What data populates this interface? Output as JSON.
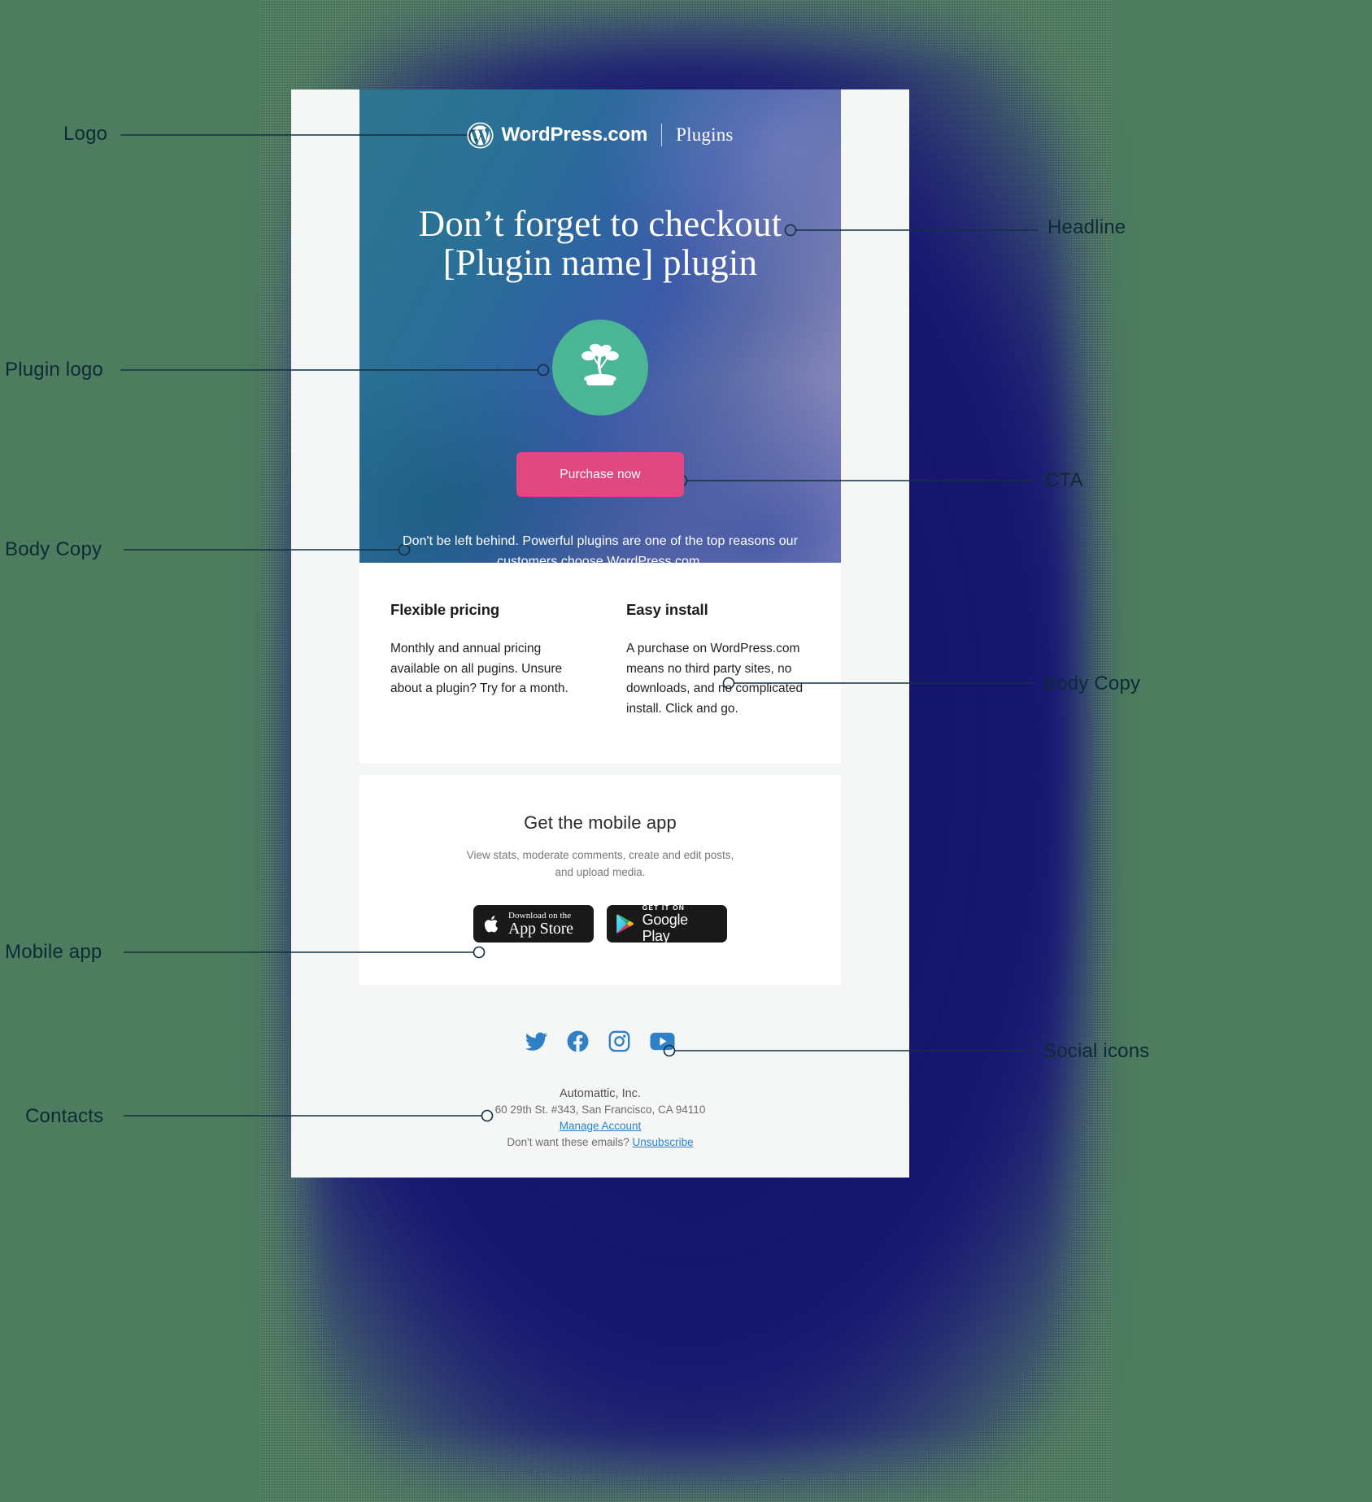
{
  "annotations": [
    {
      "id": "logo",
      "label": "Logo",
      "side": "left"
    },
    {
      "id": "headline",
      "label": "Headline",
      "side": "right"
    },
    {
      "id": "plugin-logo",
      "label": "Plugin logo",
      "side": "left"
    },
    {
      "id": "cta",
      "label": "CTA",
      "side": "right"
    },
    {
      "id": "body-copy-1",
      "label": "Body Copy",
      "side": "left"
    },
    {
      "id": "body-copy-2",
      "label": "Body Copy",
      "side": "right"
    },
    {
      "id": "mobile-app",
      "label": "Mobile app",
      "side": "left"
    },
    {
      "id": "social",
      "label": "Social icons",
      "side": "right"
    },
    {
      "id": "contacts",
      "label": "Contacts",
      "side": "left"
    }
  ],
  "email": {
    "hero": {
      "brand": {
        "name": "WordPress.com",
        "divider": "|",
        "section": "Plugins",
        "logo_icon": "wordpress-logo-icon"
      },
      "headline_line1": "Don’t forget to checkout",
      "headline_line2": "[Plugin name] plugin",
      "plugin_logo_icon": "bonsai-tree-icon",
      "plugin_logo_color": "#4ab695",
      "cta_label": "Purchase now",
      "cta_color": "#e0487f",
      "body_line1": "Don't be left behind. Powerful plugins are one of the top reasons",
      "body_line2": "our customers choose WordPress.com."
    },
    "features": [
      {
        "title": "Flexible pricing",
        "body": "Monthly and annual pricing available on all pugins. Unsure about a plugin? Try for a month."
      },
      {
        "title": "Easy install",
        "body": "A purchase on WordPress.com means no third party sites, no downloads, and no complicated install. Click and go."
      }
    ],
    "mobile": {
      "title": "Get the mobile app",
      "subtitle_line1": "View stats, moderate comments, create and",
      "subtitle_line2": "edit posts, and upload media.",
      "badges": [
        {
          "icon": "apple-icon",
          "small": "Download on the",
          "big": "App Store"
        },
        {
          "icon": "google-play-icon",
          "small": "GET IT ON",
          "big": "Google Play"
        }
      ]
    },
    "footer": {
      "social": [
        {
          "name": "twitter-icon",
          "color": "#2f80c7"
        },
        {
          "name": "facebook-icon",
          "color": "#2f80c7"
        },
        {
          "name": "instagram-icon",
          "color": "#2f80c7"
        },
        {
          "name": "youtube-icon",
          "color": "#2f80c7"
        }
      ],
      "company": "Automattic, Inc.",
      "address": "60 29th St. #343, San Francisco, CA 94110",
      "manage_link": "Manage Account",
      "unsubscribe_prefix": "Don't want these emails? ",
      "unsubscribe_link": "Unsubscribe"
    }
  }
}
